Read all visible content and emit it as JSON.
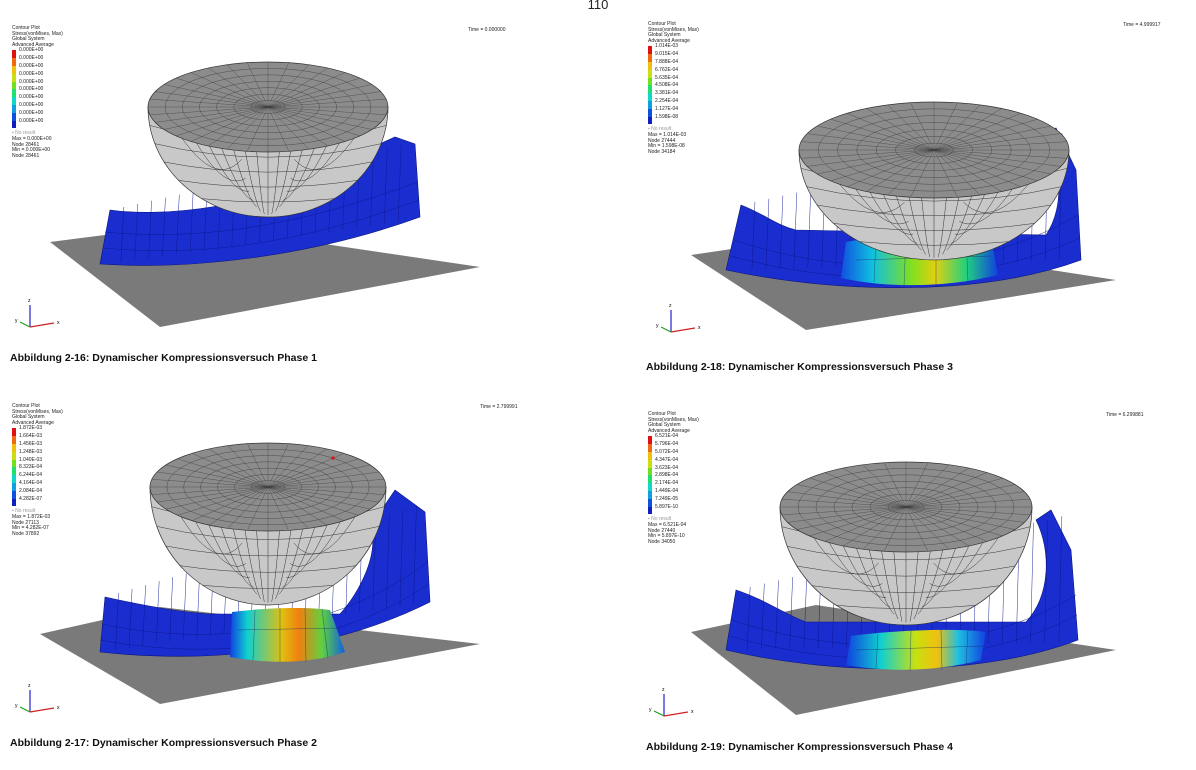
{
  "page_number": "110",
  "colors": {
    "blue": "#1a2ecf",
    "plate": "#7a7a7a",
    "sphere": "#c8c8c8",
    "mesh": "#333333"
  },
  "legend_colors": [
    "#e01010",
    "#f06a10",
    "#f0c010",
    "#c8e010",
    "#70e020",
    "#20e070",
    "#10d8c8",
    "#10a0e0",
    "#1050e0",
    "#1020c0",
    "#1010a0"
  ],
  "panels": [
    {
      "id": "p1",
      "caption": "Abbildung 2-16: Dynamischer Kompressionsversuch Phase 1",
      "time": "Time = 0.000000",
      "legend_head": [
        "Contour Plot",
        "Stress(vonMises, Max)",
        "Global System",
        "Advanced Average"
      ],
      "scale": [
        "0.000E+00",
        "0.000E+00",
        "0.000E+00",
        "0.000E+00",
        "0.000E+00",
        "0.000E+00",
        "0.000E+00",
        "0.000E+00",
        "0.000E+00",
        "0.000E+00"
      ],
      "no_result": "No result",
      "max": "Max = 0.000E+00",
      "max_node": "Node 28461",
      "min": "Min = 0.000E+00",
      "min_node": "Node 28461",
      "phase": 1
    },
    {
      "id": "p2",
      "caption": "Abbildung 2-18: Dynamischer Kompressionsversuch Phase 3",
      "time": "Time = 4.999917",
      "legend_head": [
        "Contour Plot",
        "Stress(vonMises, Max)",
        "Global System",
        "Advanced Average"
      ],
      "scale": [
        "1.014E-03",
        "9.015E-04",
        "7.888E-04",
        "6.762E-04",
        "5.635E-04",
        "4.508E-04",
        "3.381E-04",
        "2.254E-04",
        "1.127E-04",
        "1.598E-08"
      ],
      "no_result": "No result",
      "max": "Max = 1.014E-03",
      "max_node": "Node 27444",
      "min": "Min = 1.598E-08",
      "min_node": "Node 34184",
      "phase": 3
    },
    {
      "id": "p3",
      "caption": "Abbildung 2-17: Dynamischer Kompressionsversuch Phase 2",
      "time": "Time = 2.799991",
      "legend_head": [
        "Contour Plot",
        "Stress(vonMises, Max)",
        "Global System",
        "Advanced Average"
      ],
      "scale": [
        "1.872E-03",
        "1.664E-03",
        "1.456E-03",
        "1.248E-03",
        "1.040E-03",
        "8.323E-04",
        "6.244E-04",
        "4.164E-04",
        "2.084E-04",
        "4.282E-07"
      ],
      "no_result": "No result",
      "max": "Max = 1.872E-03",
      "max_node": "Node 27113",
      "min": "Min = 4.282E-07",
      "min_node": "Node 37892",
      "phase": 2
    },
    {
      "id": "p4",
      "caption": "Abbildung 2-19: Dynamischer Kompressionsversuch Phase 4",
      "time": "Time = 6.299881",
      "legend_head": [
        "Contour Plot",
        "Stress(vonMises, Max)",
        "Global System",
        "Advanced Average"
      ],
      "scale": [
        "6.521E-04",
        "5.796E-04",
        "5.072E-04",
        "4.347E-04",
        "3.623E-04",
        "2.898E-04",
        "2.174E-04",
        "1.449E-04",
        "7.249E-05",
        "5.897E-10"
      ],
      "no_result": "No result",
      "max": "Max = 6.521E-04",
      "max_node": "Node 27440",
      "min": "Min = 5.897E-10",
      "min_node": "Node 34050",
      "phase": 4
    }
  ],
  "axis": {
    "z": "z",
    "y": "y",
    "x": "x"
  }
}
